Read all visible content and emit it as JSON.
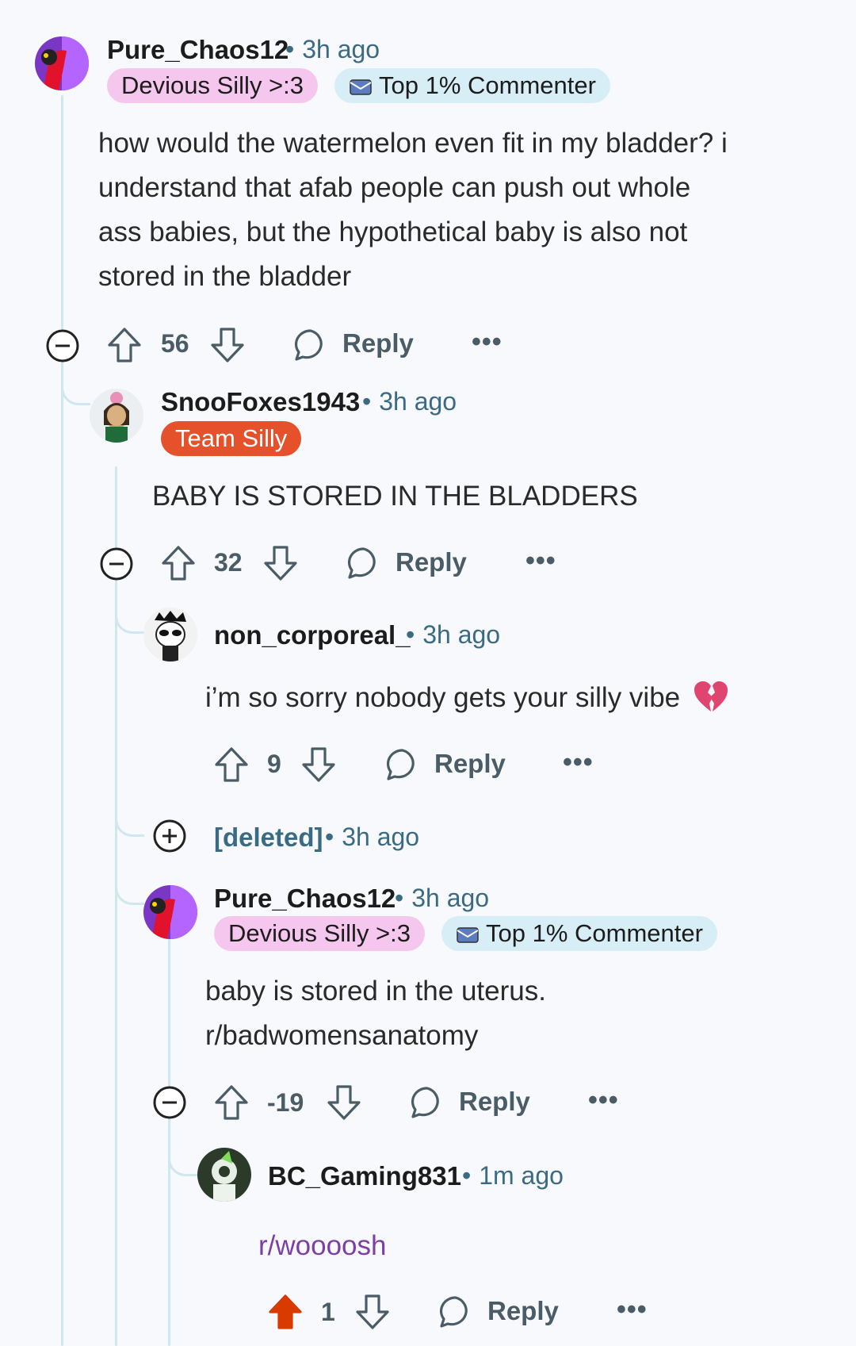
{
  "comments": [
    {
      "user": "Pure_Chaos12",
      "time": "3h ago",
      "flairs": [
        "Devious Silly >:3",
        "Top 1% Commenter"
      ],
      "body_lines": [
        "how would the watermelon even fit in my bladder? i",
        "understand that afab people can push out whole",
        "ass babies, but the hypothetical baby is also not",
        "stored in the bladder"
      ],
      "votes": "56",
      "reply": "Reply"
    },
    {
      "user": "SnooFoxes1943",
      "time": "3h ago",
      "flairs": [
        "Team Silly"
      ],
      "body_lines": [
        "BABY IS STORED IN THE BLADDERS"
      ],
      "votes": "32",
      "reply": "Reply"
    },
    {
      "user": "non_corporeal_",
      "time": "3h ago",
      "body_lines": [
        "i’m so sorry nobody gets your silly vibe"
      ],
      "emoji": "💔",
      "votes": "9",
      "reply": "Reply"
    },
    {
      "user": "[deleted]",
      "time": "3h ago"
    },
    {
      "user": "Pure_Chaos12",
      "time": "3h ago",
      "flairs": [
        "Devious Silly >:3",
        "Top 1% Commenter"
      ],
      "body_lines": [
        "baby is stored in the uterus.",
        "r/badwomensanatomy"
      ],
      "votes": "-19",
      "reply": "Reply"
    },
    {
      "user": "BC_Gaming831",
      "time": "1m ago",
      "body_lines": [
        "r/woooosh"
      ],
      "votes": "1",
      "reply": "Reply",
      "upvoted": true
    }
  ],
  "separator": "•",
  "more": "•••",
  "colors": {
    "meta": "#3b6b82",
    "flair_pink": "#f6c7ee",
    "flair_blue": "#d7eef6",
    "flair_orange": "#e5512a",
    "upvote_active": "#d93a00",
    "thread_line": "#cfe7ee",
    "link": "#7b3fa6"
  }
}
